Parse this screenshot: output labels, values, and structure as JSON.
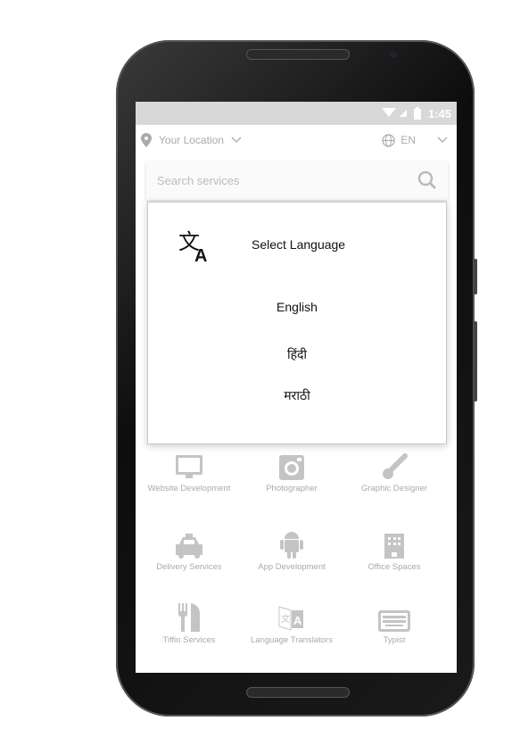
{
  "status": {
    "time": "1:45"
  },
  "topbar": {
    "location_label": "Your Location",
    "language_code": "EN"
  },
  "search": {
    "placeholder": "Search services"
  },
  "dialog": {
    "title": "Select Language",
    "options": [
      "English",
      "हिंदी",
      "मराठी"
    ]
  },
  "services": [
    {
      "label": "Website Development",
      "icon": "monitor-icon"
    },
    {
      "label": "Photographer",
      "icon": "camera-icon"
    },
    {
      "label": "Graphic Designer",
      "icon": "brush-icon"
    },
    {
      "label": "Delivery Services",
      "icon": "taxi-icon"
    },
    {
      "label": "App Development",
      "icon": "android-icon"
    },
    {
      "label": "Office Spaces",
      "icon": "building-icon"
    },
    {
      "label": "Tiffin Services",
      "icon": "fork-knife-icon"
    },
    {
      "label": "Language Translators",
      "icon": "translate-icon"
    },
    {
      "label": "Typist",
      "icon": "keyboard-icon"
    }
  ],
  "colors": {
    "icon_gray": "#c4c4c4",
    "status_bar": "#d8d8d8"
  }
}
